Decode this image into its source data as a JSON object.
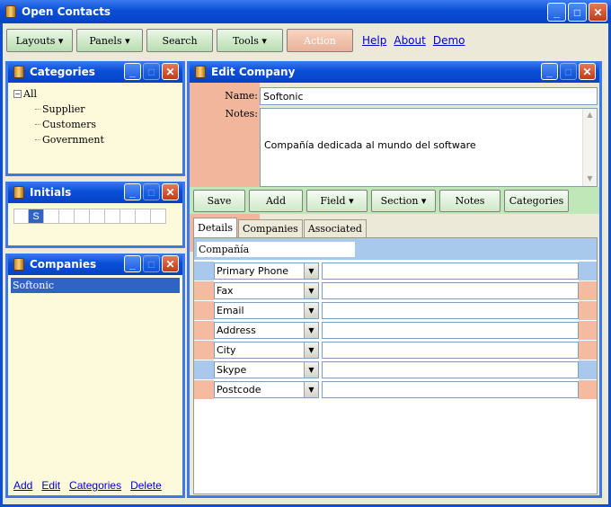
{
  "app": {
    "title": "Open Contacts"
  },
  "toolbar": {
    "layouts": "Layouts ▾",
    "panels": "Panels ▾",
    "search": "Search",
    "tools": "Tools ▾",
    "action": "Action",
    "links": [
      "Help",
      "About",
      "Demo"
    ]
  },
  "categories": {
    "title": "Categories",
    "root": "All",
    "items": [
      "Supplier",
      "Customers",
      "Government"
    ]
  },
  "initials": {
    "title": "Initials",
    "selected": "S"
  },
  "companies": {
    "title": "Companies",
    "items": [
      "Softonic"
    ],
    "links": [
      "Add",
      "Edit",
      "Categories",
      "Delete"
    ]
  },
  "edit": {
    "title": "Edit Company",
    "name_label": "Name:",
    "name_value": "Softonic",
    "notes_label": "Notes:",
    "notes_value": "Compañía dedicada al mundo del software",
    "buttons": [
      "Save",
      "Add",
      "Field ▾",
      "Section ▾",
      "Notes",
      "Categories"
    ],
    "tabs": [
      "Details",
      "Companies",
      "Associated"
    ],
    "section": "Compañía",
    "fields": [
      "Primary Phone",
      "Fax",
      "Email",
      "Address",
      "City",
      "Skype",
      "Postcode"
    ]
  },
  "colors": {
    "title_blue": "#0a4fd6",
    "panel_bg": "#fdfadb",
    "label_salmon": "#f2b69c",
    "row_blue": "#a8c8ec",
    "toolbar_green": "#bfe7b7"
  }
}
